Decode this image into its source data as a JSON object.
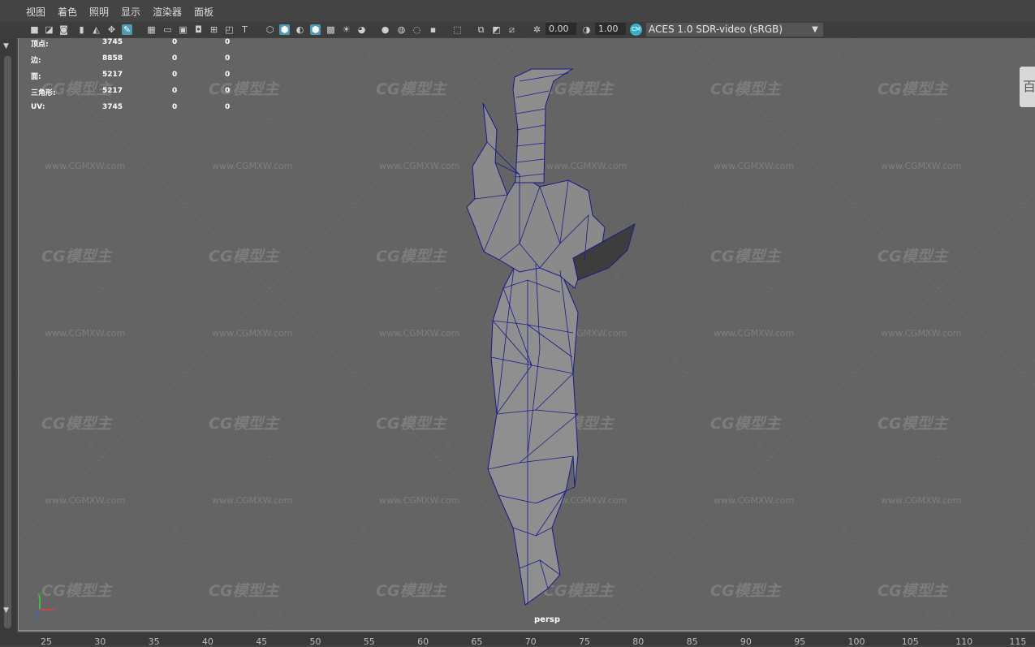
{
  "menu": [
    "视图",
    "着色",
    "照明",
    "显示",
    "渲染器",
    "面板"
  ],
  "toolbar": {
    "icons": [
      "camera-icon",
      "camera-lock-icon",
      "camera-attrs-icon",
      "bookmark-icon",
      "image-plane-icon",
      "2d-pan-icon",
      "grease-pencil-icon",
      "grid-icon",
      "film-gate-icon",
      "resolution-gate-icon",
      "gate-mask-icon",
      "field-chart-icon",
      "safe-action-icon",
      "safe-title-icon",
      "wireframe-icon",
      "smooth-shade-icon",
      "default-material-icon",
      "wireframe-on-shaded-icon",
      "xray-icon",
      "textured-icon",
      "lights-icon",
      "shadows-icon",
      "ambient-occlusion-icon",
      "motion-blur-icon",
      "anti-aliasing-icon",
      "depth-of-field-icon",
      "isolate-select-icon",
      "xray-joints-icon",
      "xray-active-icon",
      "backface-culling-icon",
      "exposure-icon",
      "gamma-icon",
      "color-management-icon"
    ],
    "exposure_value": "0.00",
    "gamma_value": "1.00",
    "colorspace": "ACES 1.0 SDR-video (sRGB)"
  },
  "hud": {
    "rows": [
      {
        "label": "顶点:",
        "v1": "3745",
        "v2": "0",
        "v3": "0"
      },
      {
        "label": "边:",
        "v1": "8858",
        "v2": "0",
        "v3": "0"
      },
      {
        "label": "面:",
        "v1": "5217",
        "v2": "0",
        "v3": "0"
      },
      {
        "label": "三角形:",
        "v1": "5217",
        "v2": "0",
        "v3": "0"
      },
      {
        "label": "UV:",
        "v1": "3745",
        "v2": "0",
        "v3": "0"
      }
    ]
  },
  "camera": "persp",
  "right_tab": "百",
  "ruler": [
    "25",
    "30",
    "35",
    "40",
    "45",
    "50",
    "55",
    "60",
    "65",
    "70",
    "75",
    "80",
    "85",
    "90",
    "95",
    "100",
    "105",
    "110",
    "115"
  ],
  "watermark": {
    "logo": "CG模型主",
    "url": "www.CGMXW.com"
  },
  "axis": {
    "y": "y",
    "x": "x",
    "z": "z"
  },
  "colors": {
    "viewport": "#646464",
    "wire": "#1a1a8c",
    "mesh": "#909090",
    "accent": "#4f9cb0"
  }
}
